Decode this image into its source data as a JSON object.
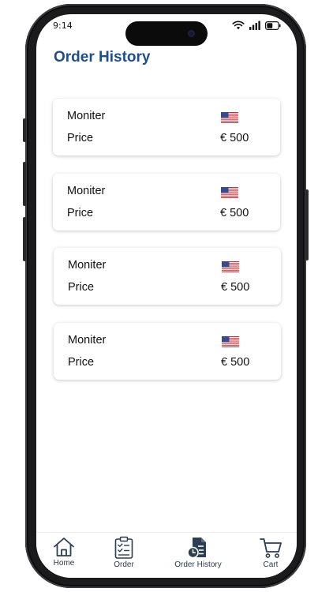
{
  "status_bar": {
    "time": "9:14"
  },
  "header": {
    "title": "Order History"
  },
  "theme": {
    "title_color": "#1f4f86",
    "card_shadow": "#d9d9d9",
    "tab_icon_color": "#2b3e52"
  },
  "orders": [
    {
      "name": "Moniter",
      "price_label": "Price",
      "currency_flag": "us-flag-icon",
      "price": "€ 500"
    },
    {
      "name": "Moniter",
      "price_label": "Price",
      "currency_flag": "us-flag-icon",
      "price": "€ 500"
    },
    {
      "name": "Moniter",
      "price_label": "Price",
      "currency_flag": "us-flag-icon",
      "price": "€ 500"
    },
    {
      "name": "Moniter",
      "price_label": "Price",
      "currency_flag": "us-flag-icon",
      "price": "€ 500"
    }
  ],
  "tab_bar": {
    "items": [
      {
        "label": "Home",
        "icon": "home-icon",
        "active": false
      },
      {
        "label": "Order",
        "icon": "order-clipboard-icon",
        "active": false
      },
      {
        "label": "Order History",
        "icon": "order-history-icon",
        "active": true
      },
      {
        "label": "Cart",
        "icon": "cart-icon",
        "active": false
      }
    ]
  }
}
